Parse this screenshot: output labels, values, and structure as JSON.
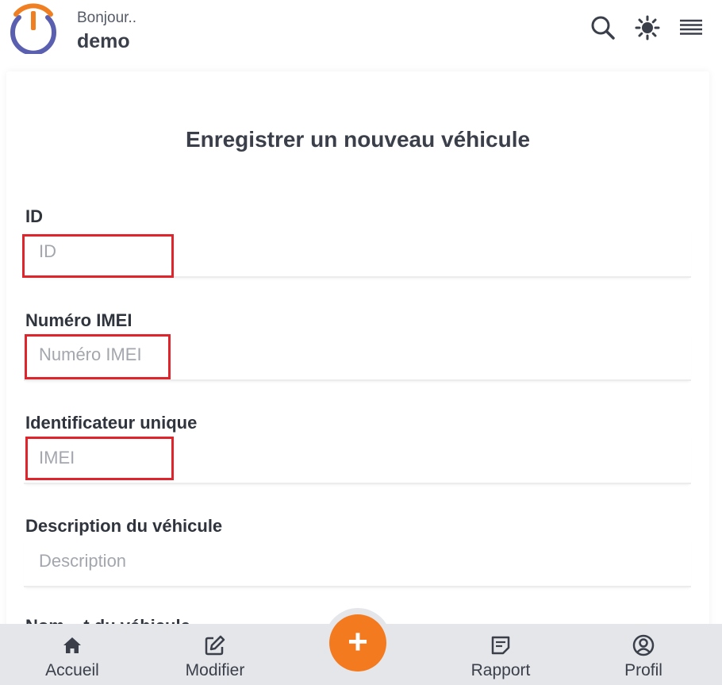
{
  "header": {
    "greeting": "Bonjour..",
    "username": "demo",
    "icons": [
      "search-icon",
      "brightness-icon",
      "menu-icon"
    ]
  },
  "form": {
    "title": "Enregistrer un nouveau véhicule",
    "fields": [
      {
        "label": "ID",
        "placeholder": "ID",
        "value": ""
      },
      {
        "label": "Numéro IMEI",
        "placeholder": "Numéro IMEI",
        "value": ""
      },
      {
        "label": "Identificateur unique",
        "placeholder": "IMEI",
        "value": ""
      },
      {
        "label": "Description du véhicule",
        "placeholder": "Description",
        "value": ""
      }
    ],
    "next_label_partial": "Nom ...t du véhicule"
  },
  "bottom_nav": {
    "items": [
      {
        "label": "Accueil",
        "icon": "home-icon"
      },
      {
        "label": "Modifier",
        "icon": "edit-icon"
      },
      {
        "label": "Rapport",
        "icon": "report-icon"
      },
      {
        "label": "Profil",
        "icon": "profile-icon"
      }
    ],
    "fab_icon": "+"
  },
  "colors": {
    "accent": "#f47a1f",
    "logo_blue": "#5a5fb0",
    "highlight": "#e0242b",
    "nav_bg": "#e5e6ea"
  }
}
